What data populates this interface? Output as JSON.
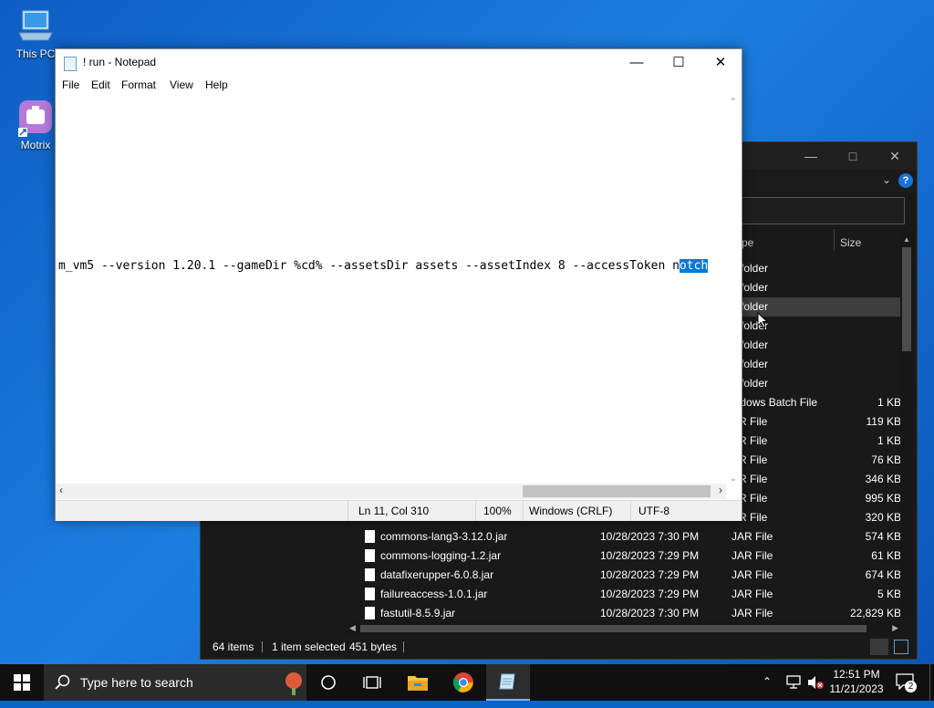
{
  "desktop": {
    "icons": [
      {
        "label": "This PC",
        "icon": "this-pc-icon"
      },
      {
        "label": "Motrix",
        "icon": "motrix-app-icon"
      }
    ]
  },
  "notepad": {
    "title": "! run - Notepad",
    "menu": [
      "File",
      "Edit",
      "Format",
      "View",
      "Help"
    ],
    "text_line": "m_vm5 --version 1.20.1 --gameDir %cd% --assetsDir assets --assetIndex 8 --accessToken n",
    "text_selected": "otch",
    "status": {
      "position": "Ln 11, Col 310",
      "zoom": "100%",
      "line_ending": "Windows (CRLF)",
      "encoding": "UTF-8"
    }
  },
  "explorer": {
    "columns": {
      "type": "pe",
      "size": "Size"
    },
    "rows": [
      {
        "name": "",
        "date": "",
        "type": "e folder",
        "size": ""
      },
      {
        "name": "",
        "date": "",
        "type": "e folder",
        "size": ""
      },
      {
        "name": "",
        "date": "",
        "type": "e folder",
        "size": "",
        "selected": true
      },
      {
        "name": "",
        "date": "",
        "type": "e folder",
        "size": ""
      },
      {
        "name": "",
        "date": "",
        "type": "e folder",
        "size": ""
      },
      {
        "name": "",
        "date": "",
        "type": "e folder",
        "size": ""
      },
      {
        "name": "",
        "date": "",
        "type": "e folder",
        "size": ""
      },
      {
        "name": "",
        "date": "",
        "type": "indows Batch File",
        "size": "1 KB"
      },
      {
        "name": "",
        "date": "",
        "type": "AR File",
        "size": "119 KB"
      },
      {
        "name": "",
        "date": "",
        "type": "AR File",
        "size": "1 KB"
      },
      {
        "name": "",
        "date": "",
        "type": "AR File",
        "size": "76 KB"
      },
      {
        "name": "",
        "date": "",
        "type": "AR File",
        "size": "346 KB"
      },
      {
        "name": "",
        "date": "",
        "type": "AR File",
        "size": "995 KB"
      },
      {
        "name": "",
        "date": "",
        "type": "AR File",
        "size": "320 KB"
      },
      {
        "name": "commons-lang3-3.12.0.jar",
        "date": "10/28/2023 7:30 PM",
        "type": "JAR File",
        "size": "574 KB"
      },
      {
        "name": "commons-logging-1.2.jar",
        "date": "10/28/2023 7:29 PM",
        "type": "JAR File",
        "size": "61 KB"
      },
      {
        "name": "datafixerupper-6.0.8.jar",
        "date": "10/28/2023 7:29 PM",
        "type": "JAR File",
        "size": "674 KB"
      },
      {
        "name": "failureaccess-1.0.1.jar",
        "date": "10/28/2023 7:29 PM",
        "type": "JAR File",
        "size": "5 KB"
      },
      {
        "name": "fastutil-8.5.9.jar",
        "date": "10/28/2023 7:30 PM",
        "type": "JAR File",
        "size": "22,829 KB"
      }
    ],
    "status": {
      "items": "64 items",
      "selected": "1 item selected",
      "bytes": "451 bytes"
    }
  },
  "taskbar": {
    "search_placeholder": "Type here to search",
    "time": "12:51 PM",
    "date": "11/21/2023",
    "notifications": "2",
    "pinned": [
      "cortana-icon",
      "task-view-icon",
      "file-explorer-icon",
      "chrome-icon",
      "notepad-icon"
    ]
  }
}
